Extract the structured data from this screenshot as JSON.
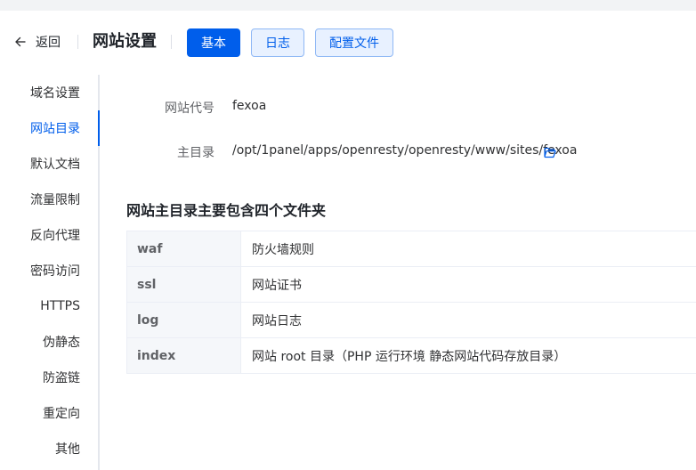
{
  "header": {
    "back_label": "返回",
    "title": "网站设置",
    "tabs": [
      {
        "label": "基本",
        "active": true
      },
      {
        "label": "日志",
        "active": false
      },
      {
        "label": "配置文件",
        "active": false
      }
    ]
  },
  "sidebar": {
    "items": [
      {
        "label": "域名设置"
      },
      {
        "label": "网站目录",
        "active": true
      },
      {
        "label": "默认文档"
      },
      {
        "label": "流量限制"
      },
      {
        "label": "反向代理"
      },
      {
        "label": "密码访问"
      },
      {
        "label": "HTTPS"
      },
      {
        "label": "伪静态"
      },
      {
        "label": "防盗链"
      },
      {
        "label": "重定向"
      },
      {
        "label": "其他"
      }
    ]
  },
  "main": {
    "site_code_label": "网站代号",
    "site_code_value": "fexoa",
    "root_dir_label": "主目录",
    "root_dir_value": "/opt/1panel/apps/openresty/openresty/www/sites/fexoa",
    "section_title": "网站主目录主要包含四个文件夹",
    "folders": [
      {
        "name": "waf",
        "desc": "防火墙规则"
      },
      {
        "name": "ssl",
        "desc": "网站证书"
      },
      {
        "name": "log",
        "desc": "网站日志"
      },
      {
        "name": "index",
        "desc": "网站 root 目录（PHP 运行环境 静态网站代码存放目录）"
      }
    ]
  },
  "colors": {
    "accent": "#005eeb",
    "accent_light_bg": "#e8f1ff",
    "page_bg": "#f2f3f5"
  },
  "icons": {
    "back": "arrow-left-icon",
    "folder": "folder-open-icon"
  }
}
